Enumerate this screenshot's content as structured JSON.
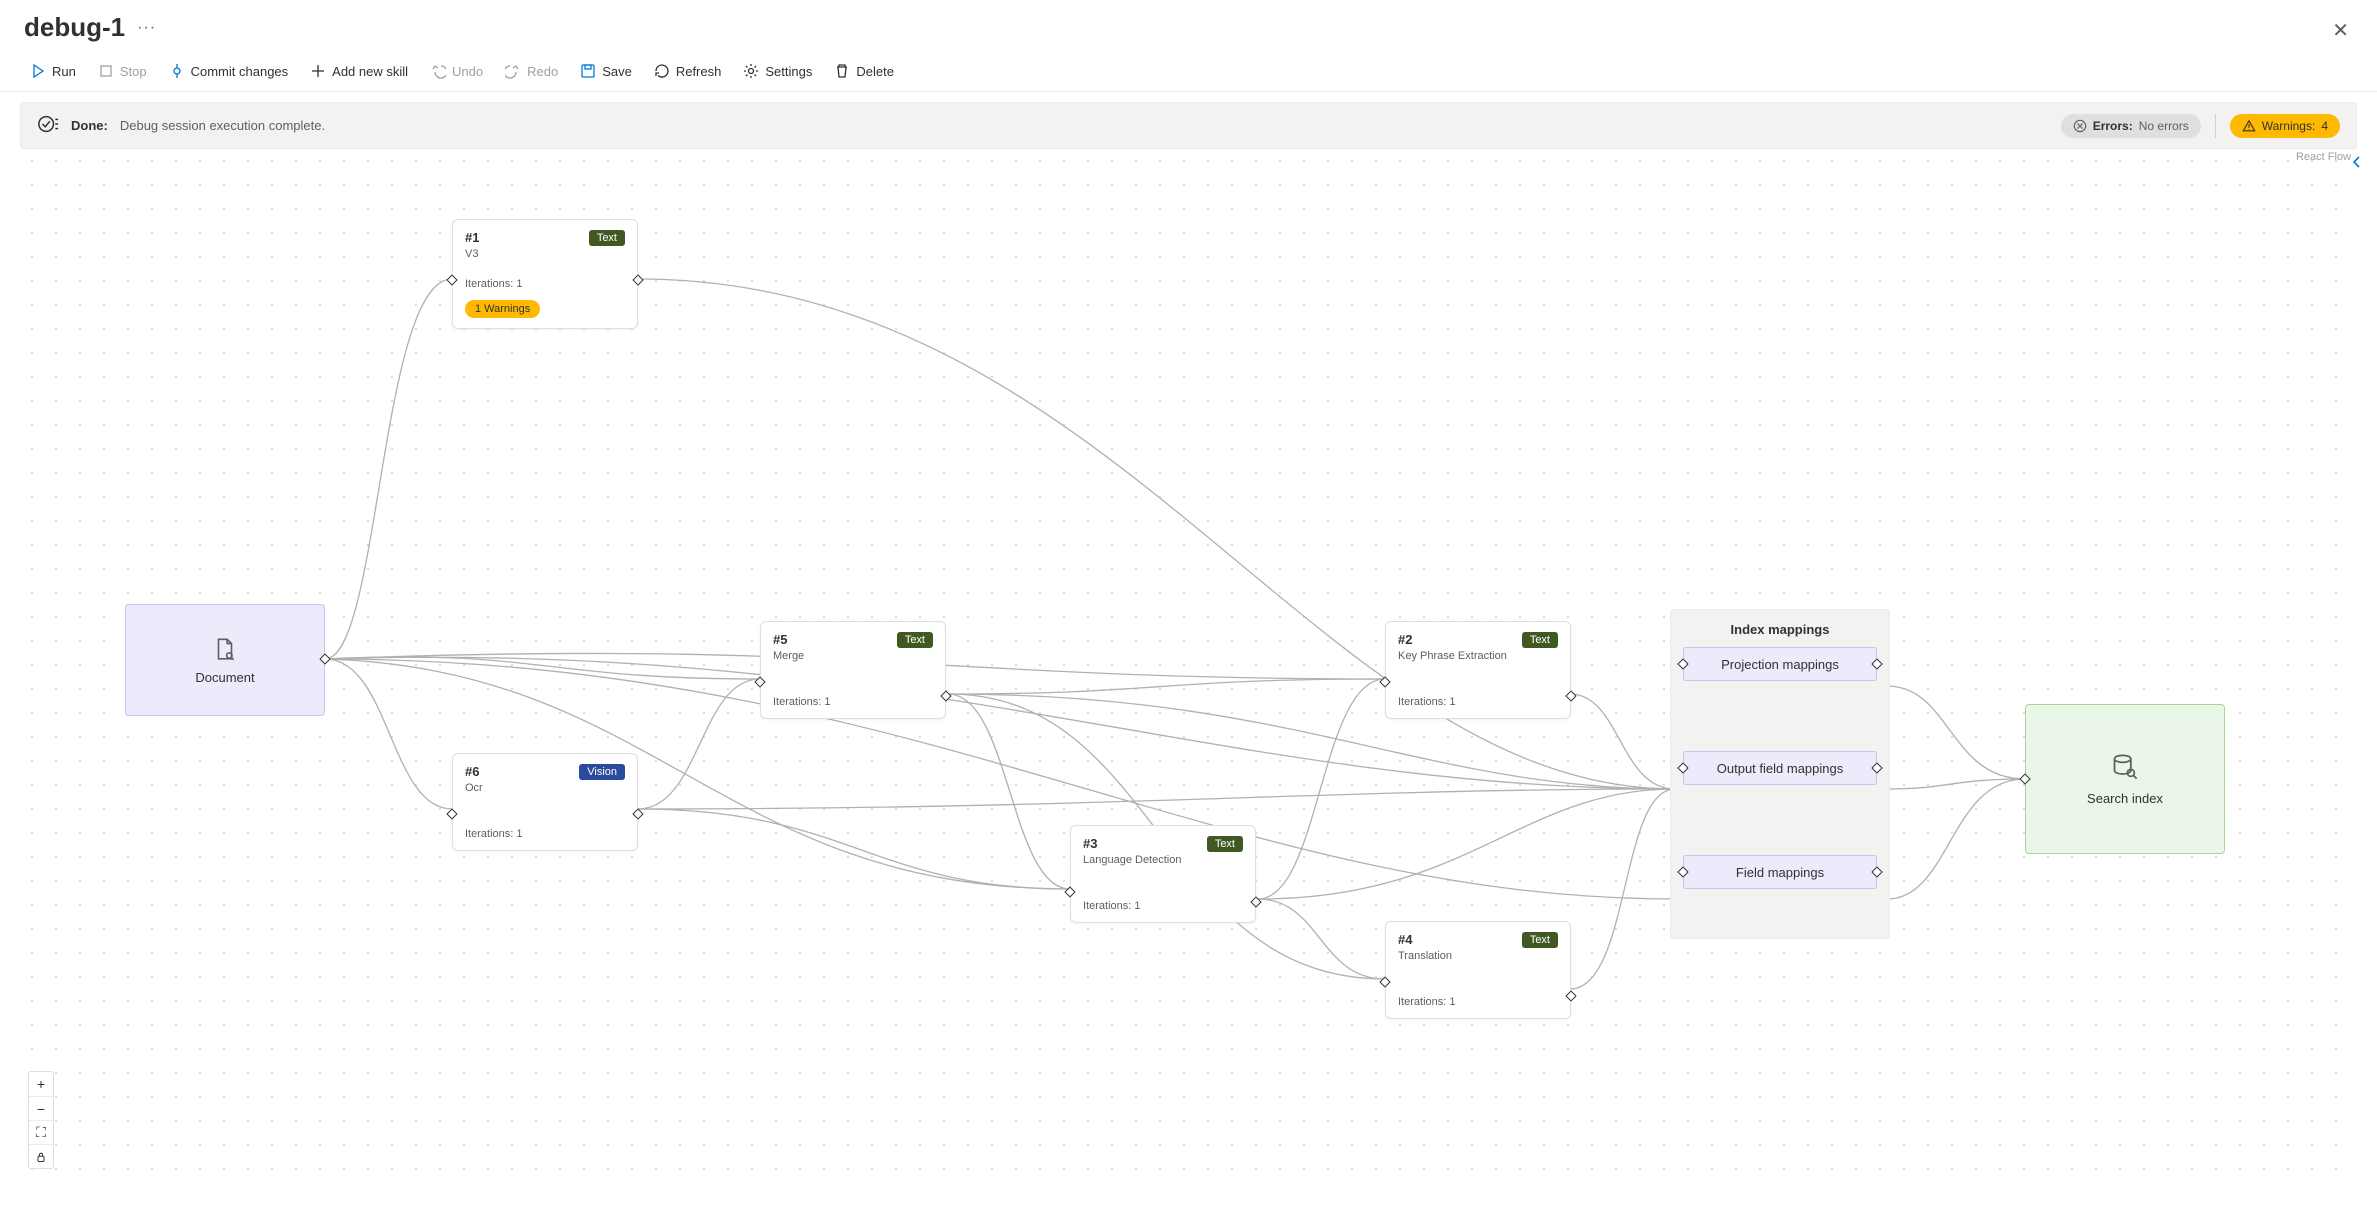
{
  "header": {
    "title": "debug-1"
  },
  "toolbar": {
    "run": "Run",
    "stop": "Stop",
    "commit": "Commit changes",
    "addskill": "Add new skill",
    "undo": "Undo",
    "redo": "Redo",
    "save": "Save",
    "refresh": "Refresh",
    "settings": "Settings",
    "delete": "Delete"
  },
  "status": {
    "label": "Done:",
    "message": "Debug session execution complete.",
    "errors_label": "Errors:",
    "errors_value": "No errors",
    "warnings_label": "Warnings:",
    "warnings_count": "4"
  },
  "attribution": "React Flow",
  "nodes": {
    "document": {
      "label": "Document"
    },
    "index": {
      "label": "Search index"
    },
    "mappings": {
      "group_title": "Index mappings",
      "projection": "Projection mappings",
      "output": "Output field mappings",
      "field": "Field mappings"
    },
    "n1": {
      "id": "#1",
      "title": "V3",
      "badge": "Text",
      "iter": "Iterations: 1",
      "warn": "1 Warnings"
    },
    "n5": {
      "id": "#5",
      "title": "Merge",
      "badge": "Text",
      "iter": "Iterations: 1"
    },
    "n6": {
      "id": "#6",
      "title": "Ocr",
      "badge": "Vision",
      "iter": "Iterations: 1"
    },
    "n3": {
      "id": "#3",
      "title": "Language Detection",
      "badge": "Text",
      "iter": "Iterations: 1"
    },
    "n2": {
      "id": "#2",
      "title": "Key Phrase Extraction",
      "badge": "Text",
      "iter": "Iterations: 1"
    },
    "n4": {
      "id": "#4",
      "title": "Translation",
      "badge": "Text",
      "iter": "Iterations: 1"
    }
  }
}
